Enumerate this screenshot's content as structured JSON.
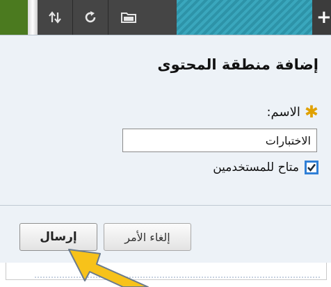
{
  "toolbar": {
    "icons": [
      "sort-icon",
      "refresh-icon",
      "folder-icon",
      "add-icon"
    ],
    "add_symbol": "+",
    "accent_green": "#4b7a1f",
    "accent_teal": "#3aa7bd"
  },
  "dialog": {
    "title": "إضافة منطقة المحتوى",
    "name_label": "الاسم:",
    "required_symbol": "✱",
    "name_value": "الاختبارات",
    "available_checked": true,
    "available_label": "متاح للمستخدمين",
    "cancel_label": "إلغاء الأمر",
    "submit_label": "إرسال"
  },
  "annotation": {
    "arrow_color": "#f7c21a"
  }
}
